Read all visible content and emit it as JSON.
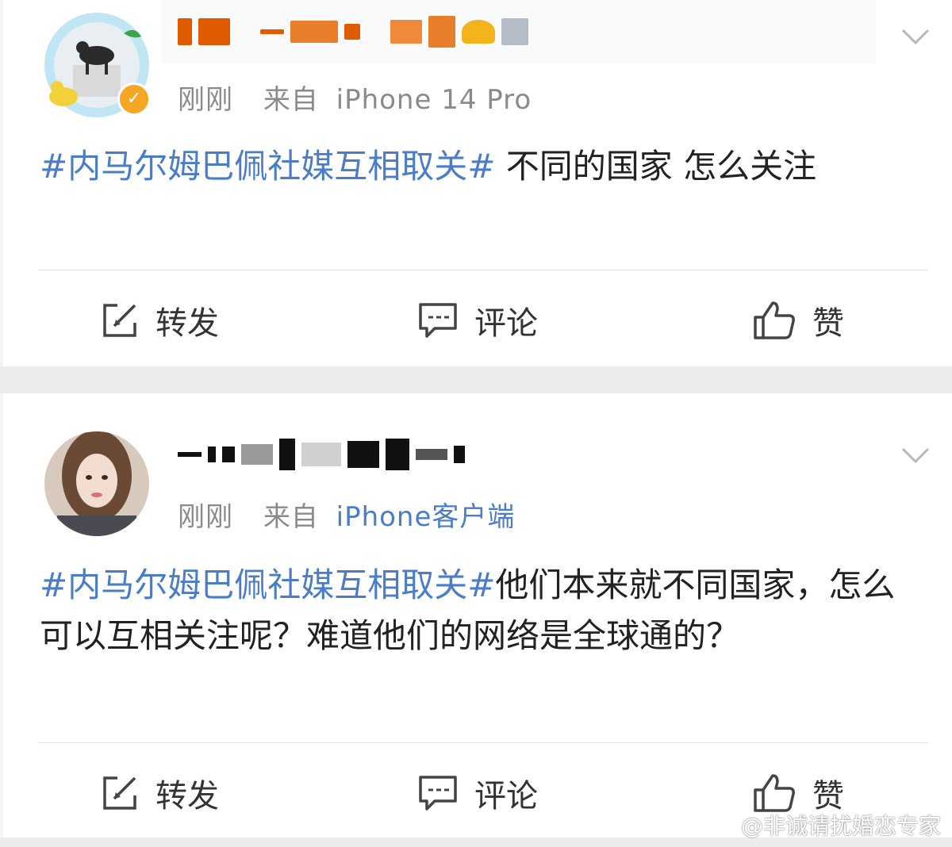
{
  "posts": [
    {
      "time": "刚刚",
      "source_prefix": "来自",
      "device": "iPhone 14 Pro",
      "hashtag": "#内马尔姆巴佩社媒互相取关#",
      "text": " 不同的国家 怎么关注"
    },
    {
      "time": "刚刚",
      "source_prefix": "来自",
      "device": "iPhone客户端",
      "hashtag": "#内马尔姆巴佩社媒互相取关#",
      "text": "他们本来就不同国家，怎么可以互相关注呢？难道他们的网络是全球通的？"
    }
  ],
  "actions": {
    "repost_label": "转发",
    "comment_label": "评论",
    "like_label": "赞"
  },
  "icons": {
    "repost": "share-edit-icon",
    "comment": "comment-bubble-icon",
    "like": "thumbs-up-icon",
    "more": "chevron-down-icon",
    "verified": "verified-badge-icon"
  },
  "watermark": "@非诚请扰婚恋专家",
  "colors": {
    "link": "#4a7cc7",
    "meta": "#8a8a8a",
    "verified": "#f5a623"
  }
}
